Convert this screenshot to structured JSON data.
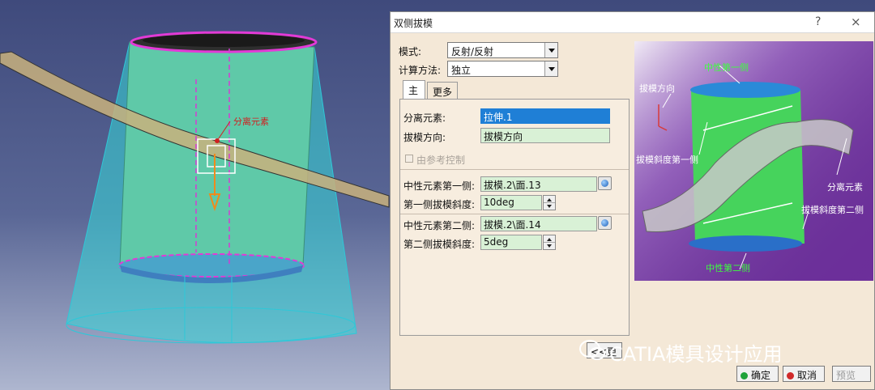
{
  "viewport": {
    "annotation": "分离元素"
  },
  "dialog": {
    "title": "双侧拔模",
    "help": "?",
    "close": "×",
    "mode_label": "模式:",
    "mode_value": "反射/反射",
    "calc_label": "计算方法:",
    "calc_value": "独立",
    "tabs": [
      {
        "label": "主"
      },
      {
        "label": "更多"
      }
    ],
    "fields": {
      "parting_label": "分离元素:",
      "parting_value": "拉伸.1",
      "direction_label": "拔模方向:",
      "direction_value": "拔模方向",
      "ref_control_label": "由参考控制",
      "neutral1_label": "中性元素第一侧:",
      "neutral1_value": "拔模.2\\面.13",
      "angle1_label": "第一侧拔模斜度:",
      "angle1_value": "10deg",
      "neutral2_label": "中性元素第二侧:",
      "neutral2_value": "拔模.2\\面.14",
      "angle2_label": "第二侧拔模斜度:",
      "angle2_value": "5deg"
    },
    "less_button": "<<更",
    "ok_button": "确定",
    "cancel_button": "取消",
    "preview_button": "预览",
    "preview_labels": {
      "neutral1": "中性第一侧",
      "direction": "拔模方向",
      "angle1": "拔模斜度第一侧",
      "parting": "分离元素",
      "angle2": "拔模斜度第二侧",
      "neutral2": "中性第二侧"
    }
  },
  "watermark": "CATIA模具设计应用",
  "colors": {
    "accent_selected": "#1f7fd6",
    "field_green": "#d9f1d6",
    "dialog_bg": "#f4e8d7",
    "preview_bg": "#6d2f9b",
    "part_teal": "#5fc9a8"
  }
}
